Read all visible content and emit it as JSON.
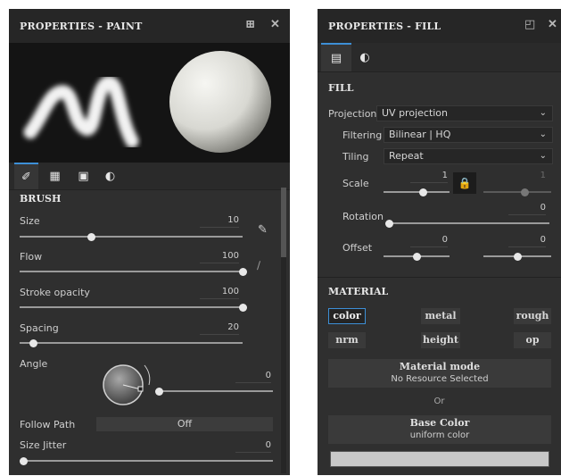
{
  "paint": {
    "title": "PROPERTIES - PAINT",
    "tabs": [
      "brush-tab",
      "alpha-tab",
      "stencil-tab",
      "material-tab"
    ],
    "brush_section": "BRUSH",
    "size": {
      "label": "Size",
      "value": "10",
      "fraction": 0.32
    },
    "flow": {
      "label": "Flow",
      "value": "100",
      "fraction": 1.0
    },
    "stroke_opacity": {
      "label": "Stroke opacity",
      "value": "100",
      "fraction": 1.0
    },
    "spacing": {
      "label": "Spacing",
      "value": "20",
      "fraction": 0.06
    },
    "angle": {
      "label": "Angle",
      "value": "0",
      "fraction": 0.0
    },
    "follow_path": {
      "label": "Follow Path",
      "value": "Off"
    },
    "size_jitter": {
      "label": "Size Jitter",
      "value": "0",
      "fraction": 0.0
    }
  },
  "fill": {
    "title": "PROPERTIES - FILL",
    "fill_section": "FILL",
    "projection": {
      "label": "Projection",
      "value": "UV projection"
    },
    "filtering": {
      "label": "Filtering",
      "value": "Bilinear | HQ"
    },
    "tiling": {
      "label": "Tiling",
      "value": "Repeat"
    },
    "scale": {
      "label": "Scale",
      "value": "1",
      "value2": "1",
      "fraction": 0.6
    },
    "rotation": {
      "label": "Rotation",
      "value": "0",
      "fraction": 0.0
    },
    "offset": {
      "label": "Offset",
      "value": "0",
      "value2": "0",
      "fraction": 0.5
    },
    "material_section": "MATERIAL",
    "channels": [
      "color",
      "metal",
      "rough",
      "nrm",
      "height",
      "op"
    ],
    "material_mode": {
      "title": "Material mode",
      "subtitle": "No Resource Selected"
    },
    "or_text": "Or",
    "base_color": {
      "title": "Base Color",
      "subtitle": "uniform color",
      "swatch": "#c8c8c8"
    }
  },
  "colors": {
    "accent": "#3d8fd6",
    "panel": "#2f2f2f",
    "knob": "#e8e8e8"
  }
}
